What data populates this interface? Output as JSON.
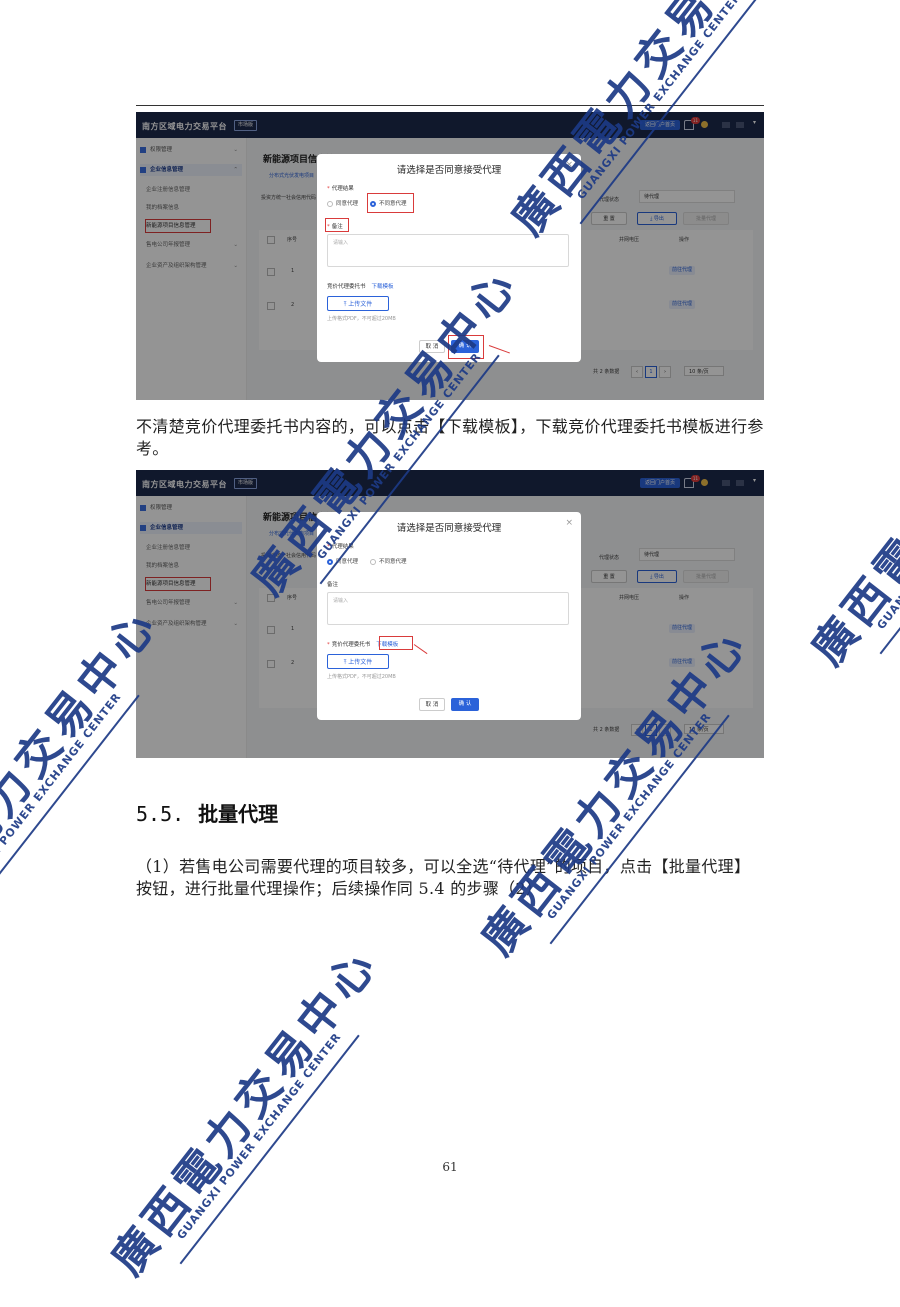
{
  "app": {
    "brand": "南方区域电力交易平台",
    "brand_tag": "市场版",
    "home_button": "返回门户首页",
    "notification_count": "11"
  },
  "sidebar": {
    "items": [
      {
        "label": "权限管理"
      },
      {
        "label": "企业信息管理"
      },
      {
        "label": "企业注册信息管理"
      },
      {
        "label": "我的档案信息"
      },
      {
        "label": "新能源项目信息管理"
      },
      {
        "label": "售电公司年报管理"
      },
      {
        "label": "企业资产及组织架构管理"
      }
    ]
  },
  "main": {
    "page_title": "新能源项目信息管理",
    "sub_tab": "分布式光伏发电项目",
    "filter_label": "投资方统一社会信用代码",
    "status_label": "代理状态",
    "status_value": "待代理",
    "reset_button": "重 置",
    "export_button": "导出",
    "batch_button": "批量代理",
    "table": {
      "headers": [
        "序号",
        "并网电压",
        "操作"
      ],
      "rows": [
        {
          "index": "1",
          "action": "前往代理"
        },
        {
          "index": "2",
          "action": "前往代理"
        }
      ]
    },
    "pagination": {
      "total": "共 2 条数据",
      "current": "1",
      "page_size": "10 条/页"
    }
  },
  "modal": {
    "title": "请选择是否同意接受代理",
    "result_label": "代理结果",
    "option_agree": "同意代理",
    "option_disagree": "不同意代理",
    "remark_label": "备注",
    "remark_placeholder": "请输入",
    "attorney_label": "竞价代理委托书",
    "download_template": "下载模板",
    "upload_button": "上传文件",
    "upload_hint": "上传格式PDF，不可超过20MB",
    "cancel_button": "取 消",
    "confirm_button": "确 认"
  },
  "text": {
    "para1": "不清楚竞价代理委托书内容的，可以点击【下载模板】，下载竞价代理委托书模板进行参考。",
    "heading_num": "5.5.",
    "heading_title": "批量代理",
    "para2": "（1）若售电公司需要代理的项目较多，可以全选“待代理”的项目，点击【批量代理】按钮，进行批量代理操作；后续操作同 5.4 的步骤（2）",
    "page_number": "61"
  },
  "watermark": {
    "cn": "廣西電力交易中心",
    "en": "GUANGXI POWER EXCHANGE CENTER"
  },
  "colors": {
    "topbar": "#1d2a4d",
    "primary": "#2b62d9",
    "highlight_red": "#d93b3b",
    "watermark": "#1d3a86"
  }
}
